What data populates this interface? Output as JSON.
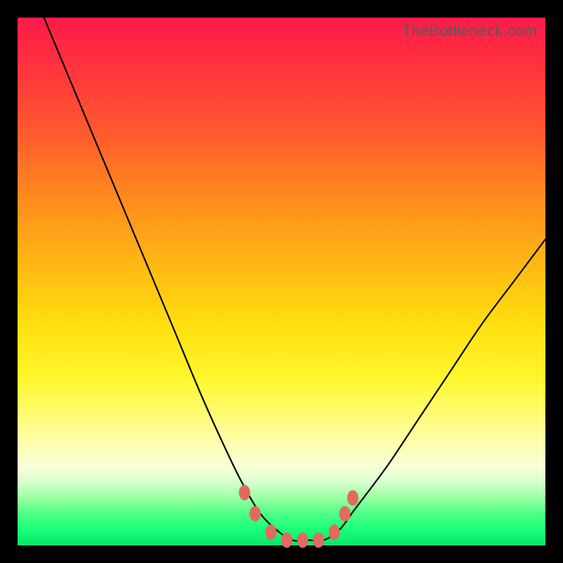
{
  "attribution": "TheBottleneck.com",
  "colors": {
    "frame": "#000000",
    "gradient_top": "#ff1a4a",
    "gradient_bottom": "#07e66a",
    "curve": "#000000",
    "markers": "#e26a5f",
    "attrib_text": "#5a5a5a"
  },
  "chart_data": {
    "type": "line",
    "title": "",
    "xlabel": "",
    "ylabel": "",
    "xlim": [
      0,
      100
    ],
    "ylim": [
      0,
      100
    ],
    "annotations": [
      "TheBottleneck.com"
    ],
    "legend": false,
    "grid": false,
    "series": [
      {
        "name": "bottleneck-curve",
        "x": [
          5,
          10,
          15,
          20,
          25,
          30,
          35,
          40,
          43,
          46,
          49,
          52,
          55,
          58,
          61,
          64,
          70,
          76,
          82,
          88,
          94,
          100
        ],
        "y": [
          100,
          88,
          76,
          64,
          52,
          40,
          28,
          17,
          11,
          6,
          3,
          1,
          1,
          1,
          3,
          7,
          15,
          24,
          33,
          42,
          50,
          58
        ]
      }
    ],
    "markers": {
      "name": "highlight-points",
      "x": [
        43,
        45,
        48,
        51,
        54,
        57,
        60,
        62,
        63.5
      ],
      "y": [
        10,
        6,
        2.5,
        1,
        1,
        1,
        2.5,
        6,
        9
      ]
    }
  }
}
